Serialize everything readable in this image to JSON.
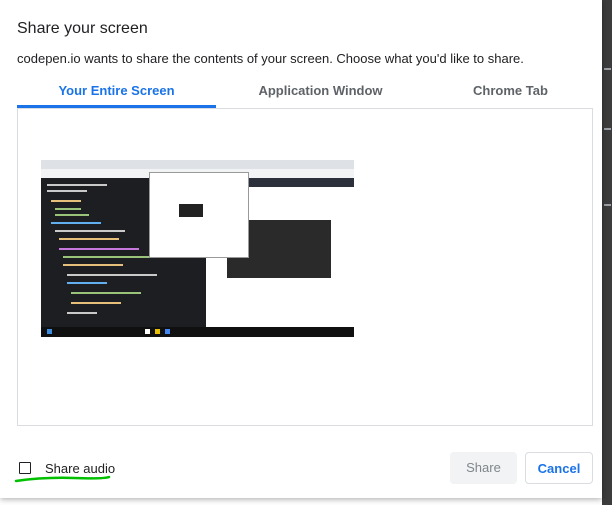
{
  "dialog": {
    "title": "Share your screen",
    "subtitle": "codepen.io wants to share the contents of your screen. Choose what you'd like to share."
  },
  "tabs": [
    {
      "label": "Your Entire Screen",
      "active": true
    },
    {
      "label": "Application Window",
      "active": false
    },
    {
      "label": "Chrome Tab",
      "active": false
    }
  ],
  "preview": {
    "icon": "screen-thumbnail"
  },
  "audio": {
    "label": "Share audio",
    "checked": false
  },
  "buttons": {
    "share_label": "Share",
    "cancel_label": "Cancel"
  },
  "colors": {
    "accent": "#1a73e8",
    "annotation": "#00c000"
  }
}
